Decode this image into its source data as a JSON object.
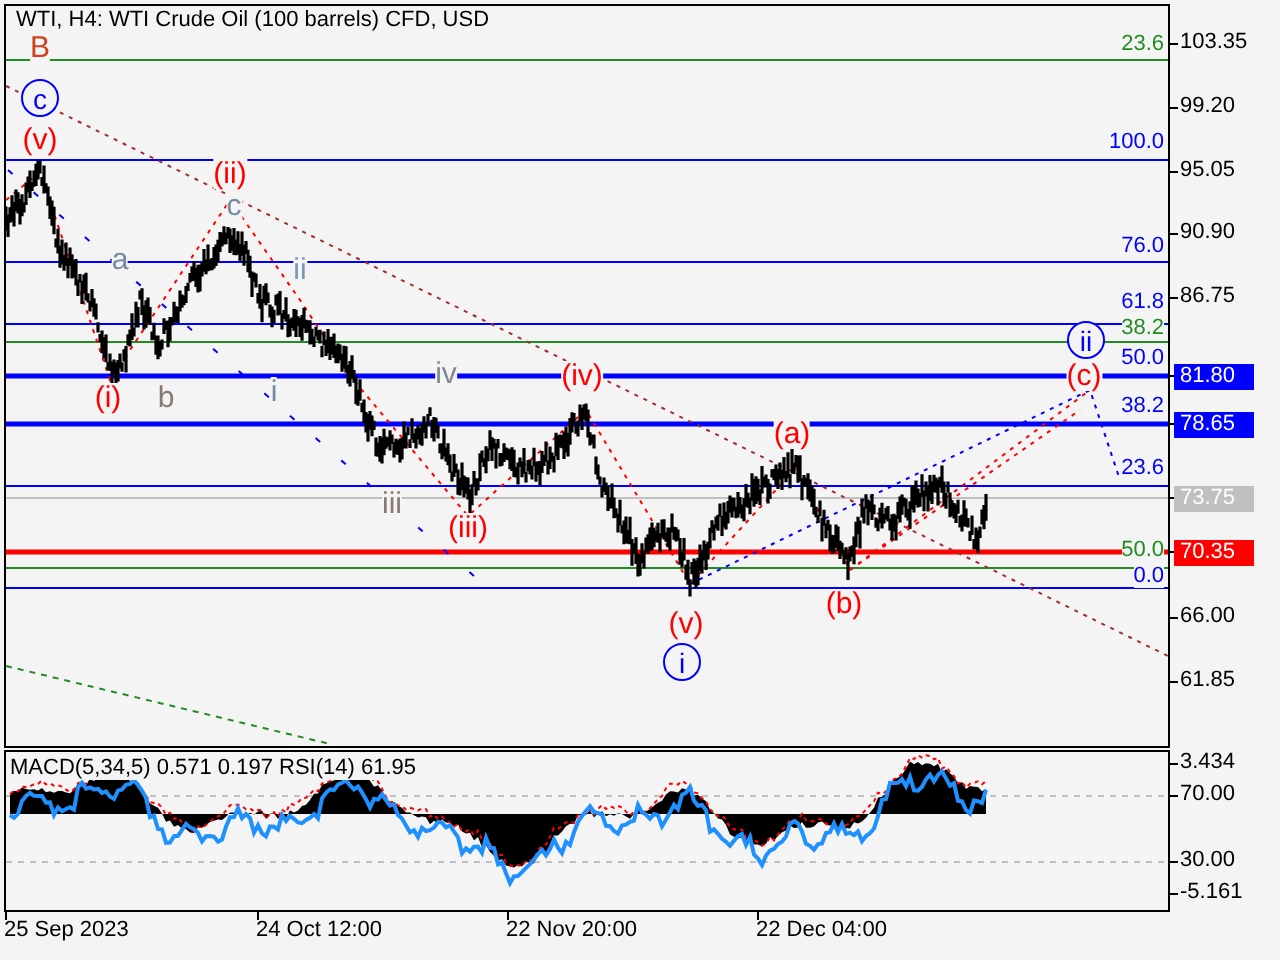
{
  "title": "WTI, H4:  WTI Crude Oil (100 barrels) CFD, USD",
  "fib_labels": [
    {
      "text": "23.6",
      "color": "#228b22"
    },
    {
      "text": "100.0",
      "color": "#0000ff"
    },
    {
      "text": "76.0",
      "color": "#0000ff"
    },
    {
      "text": "61.8",
      "color": "#0000ff"
    },
    {
      "text": "38.2",
      "color": "#228b22"
    },
    {
      "text": "50.0",
      "color": "#0000ff"
    },
    {
      "text": "38.2",
      "color": "#0000ff"
    },
    {
      "text": "23.6",
      "color": "#0000ff"
    },
    {
      "text": "50.0",
      "color": "#228b22"
    },
    {
      "text": "0.0",
      "color": "#0000ff"
    }
  ],
  "wave_labels": [
    {
      "text": "B",
      "color": "#d2401e",
      "kind": "plain"
    },
    {
      "text": "c",
      "color": "#0000ff",
      "kind": "circled"
    },
    {
      "text": "(v)",
      "color": "#ff0000",
      "kind": "plain"
    },
    {
      "text": "(ii)",
      "color": "#ff0000",
      "kind": "plain"
    },
    {
      "text": "c",
      "color": "#7888a0",
      "kind": "plain"
    },
    {
      "text": "a",
      "color": "#7888a0",
      "kind": "plain"
    },
    {
      "text": "ii",
      "color": "#7898b8",
      "kind": "plain"
    },
    {
      "text": "(i)",
      "color": "#ff0000",
      "kind": "plain"
    },
    {
      "text": "b",
      "color": "#8a7a70",
      "kind": "plain"
    },
    {
      "text": "i",
      "color": "#7888a0",
      "kind": "plain"
    },
    {
      "text": "iv",
      "color": "#808890",
      "kind": "plain"
    },
    {
      "text": "(iv)",
      "color": "#ff0000",
      "kind": "plain"
    },
    {
      "text": "iii",
      "color": "#8a7a70",
      "kind": "plain"
    },
    {
      "text": "(iii)",
      "color": "#ff0000",
      "kind": "plain"
    },
    {
      "text": "(a)",
      "color": "#ff0000",
      "kind": "plain"
    },
    {
      "text": "(b)",
      "color": "#ff0000",
      "kind": "plain"
    },
    {
      "text": "(v)",
      "color": "#ff0000",
      "kind": "plain"
    },
    {
      "text": "i",
      "color": "#0000ff",
      "kind": "circled"
    },
    {
      "text": "ii",
      "color": "#0000ff",
      "kind": "circled"
    },
    {
      "text": "(c)",
      "color": "#ff0000",
      "kind": "plain"
    }
  ],
  "price_axis": [
    {
      "text": "103.35",
      "kind": "tick"
    },
    {
      "text": "99.20",
      "kind": "tick"
    },
    {
      "text": "95.05",
      "kind": "tick"
    },
    {
      "text": "90.90",
      "kind": "tick"
    },
    {
      "text": "86.75",
      "kind": "tick"
    },
    {
      "text": "81.80",
      "kind": "marker",
      "color": "#0000ff"
    },
    {
      "text": "78.65",
      "kind": "marker",
      "color": "#0000ff"
    },
    {
      "text": "73.75",
      "kind": "marker",
      "color": "#c0c0c0"
    },
    {
      "text": "70.35",
      "kind": "marker",
      "color": "#ff0000"
    },
    {
      "text": "66.00",
      "kind": "tick"
    },
    {
      "text": "61.85",
      "kind": "tick"
    }
  ],
  "indicator": {
    "title": "MACD(5,34,5) 0.571 0.197 RSI(14) 61.95",
    "axis": [
      "3.434",
      "70.00",
      "30.00",
      "-5.161"
    ]
  },
  "time_axis": [
    "25 Sep 2023",
    "24 Oct 12:00",
    "22 Nov 20:00",
    "22 Dec 04:00"
  ]
}
